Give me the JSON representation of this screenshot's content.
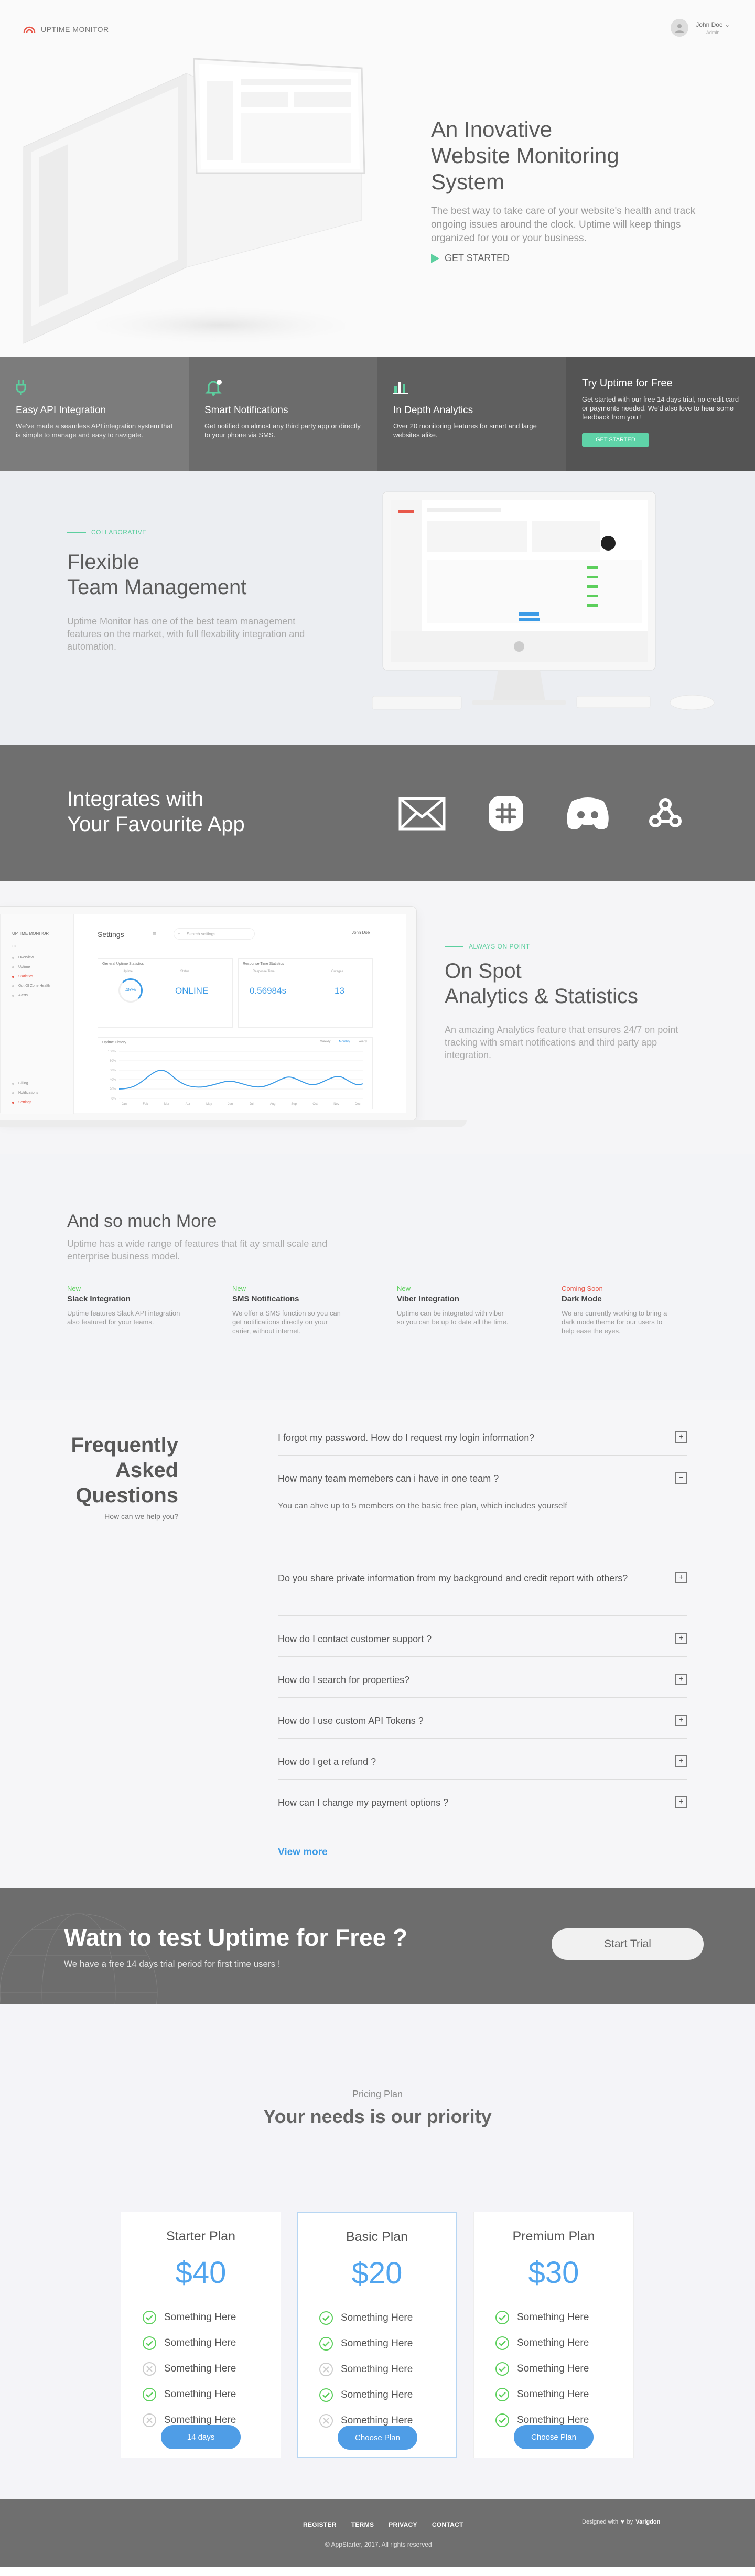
{
  "brand": {
    "logo_text": "UPTIME MONITOR",
    "accent": "#e8584a"
  },
  "user": {
    "name": "John Doe",
    "role": "Admin"
  },
  "hero": {
    "title_lines": [
      "An Inovative",
      "Website Monitoring",
      "System"
    ],
    "description": "The best way to take care of your website's health and track ongoing issues around the clock. Uptime will keep things organized for you or your business.",
    "cta": "GET STARTED"
  },
  "features": [
    {
      "title": "Easy API Integration",
      "text": "We've made a seamless API integration system that is simple to manage and easy to navigate.",
      "bg": "#7c7c7c",
      "icon": "plug-icon"
    },
    {
      "title": "Smart Notifications",
      "text": "Get notified on almost any third party app or directly to your phone via SMS.",
      "bg": "#6c6c6c",
      "icon": "bell-icon"
    },
    {
      "title": "In Depth Analytics",
      "text": "Over 20 monitoring features for smart and large websites alike.",
      "bg": "#5f5f5f",
      "icon": "bar-chart-icon"
    },
    {
      "title": "Try Uptime for Free",
      "text": "Get started with our free 14 days trial, no credit card or payments needed. We'd also love to hear some feedback from you !",
      "bg": "#545454",
      "button": "GET STARTED"
    }
  ],
  "team": {
    "tag": "COLLABORATIVE",
    "title_lines": [
      "Flexible",
      "Team Management"
    ],
    "description": "Uptime Monitor has one of the best team management features on the market, with full flexability integration and automation."
  },
  "integrations": {
    "title_lines": [
      "Integrates with",
      "Your Favourite App"
    ],
    "apps": [
      "mail-icon",
      "slack-icon",
      "discord-icon",
      "webhook-icon"
    ]
  },
  "analytics": {
    "tag": "ALWAYS ON POINT",
    "title_lines": [
      "On Spot",
      "Analytics & Statistics"
    ],
    "description": "An amazing Analytics feature that ensures 24/7 on point tracking with smart notifications and third party app integration."
  },
  "dashboard": {
    "page": "Settings",
    "search": "Search settings",
    "user": "John Doe",
    "nav": [
      "Overview",
      "Uptime",
      "Statistics",
      "Out Of Zone Health",
      "Alerts"
    ],
    "nav2": [
      "Billing",
      "Notifications",
      "Settings"
    ],
    "stats": [
      {
        "label": "Uptime",
        "value": "45%"
      },
      {
        "label": "Status",
        "value": "ONLINE"
      },
      {
        "label": "Response Time",
        "value": "0.56984s"
      },
      {
        "label": "Outages",
        "value": "13"
      }
    ],
    "panel1": "General Uptime Statistics",
    "panel2": "Response Time Statistics",
    "chart_title": "Uptime History",
    "chart_tabs": [
      "Weekly",
      "Monthly",
      "Yearly"
    ],
    "yticks": [
      "100%",
      "80%",
      "60%",
      "40%",
      "20%",
      "0%"
    ],
    "xticks": [
      "Jan",
      "Feb",
      "Mar",
      "Apr",
      "May",
      "Jun",
      "Jul",
      "Aug",
      "Sep",
      "Oct",
      "Nov",
      "Dec"
    ]
  },
  "more": {
    "title": "And so much More",
    "description": "Uptime has a wide range of features that fit ay small scale and enterprise business model.",
    "items": [
      {
        "tag": "New",
        "tag_color": "#5ccf5c",
        "title": "Slack Integration",
        "text": "Uptime features Slack API integration also featured for your teams."
      },
      {
        "tag": "New",
        "tag_color": "#5ccf5c",
        "title": "SMS Notifications",
        "text": "We offer a SMS function so you can get notifications directly on your carier, without internet."
      },
      {
        "tag": "New",
        "tag_color": "#5ccf5c",
        "title": "Viber Integration",
        "text": "Uptime can be integrated with viber so you can be up to date all the time."
      },
      {
        "tag": "Coming Soon",
        "tag_color": "#e8584a",
        "title": "Dark Mode",
        "text": "We are currently working to bring a dark mode theme for our users to help ease the eyes."
      }
    ]
  },
  "faq": {
    "title_lines": [
      "Frequently",
      "Asked",
      "Questions"
    ],
    "subtitle": "How can we help you?",
    "view_all": "View more",
    "items": [
      {
        "q": "I forgot my password. How do I request my login information?"
      },
      {
        "q": "How many team memebers can i have  in one team ?",
        "a": "You can ahve up to 5 members on the basic free plan, which includes yourself"
      },
      {
        "q": "Do you share private information from my background and credit report with others?"
      },
      {
        "q": "How do I contact customer support ?"
      },
      {
        "q": "How do I search for properties?"
      },
      {
        "q": "How do I use custom API Tokens ?"
      },
      {
        "q": "How do I get a refund ?"
      },
      {
        "q": "How can I change my payment options ?"
      }
    ]
  },
  "cta": {
    "title": "Watn to test Uptime for Free ?",
    "text": "We have a free 14 days trial period for first time users !",
    "button": "Start Trial"
  },
  "pricing": {
    "label": "Pricing Plan",
    "title": "Your needs is our priority",
    "plans": [
      {
        "name": "Starter Plan",
        "price": "$40",
        "button": "14 days",
        "features": [
          [
            "Something Here",
            true
          ],
          [
            "Something Here",
            true
          ],
          [
            "Something Here",
            false
          ],
          [
            "Something Here",
            true
          ],
          [
            "Something Here",
            false
          ]
        ]
      },
      {
        "name": "Basic Plan",
        "price": "$20",
        "button": "Choose Plan",
        "features": [
          [
            "Something Here",
            true
          ],
          [
            "Something Here",
            true
          ],
          [
            "Something Here",
            false
          ],
          [
            "Something Here",
            true
          ],
          [
            "Something Here",
            false
          ]
        ]
      },
      {
        "name": "Premium Plan",
        "price": "$30",
        "button": "Choose Plan",
        "features": [
          [
            "Something Here",
            true
          ],
          [
            "Something Here",
            true
          ],
          [
            "Something Here",
            true
          ],
          [
            "Something Here",
            true
          ],
          [
            "Something Here",
            true
          ]
        ]
      }
    ]
  },
  "footer": {
    "links": [
      "REGISTER",
      "TERMS",
      "PRIVACY",
      "CONTACT"
    ],
    "copyright": "© AppStarter, 2017. All rights reserved",
    "designed_prefix": "Designed with",
    "designed_by": "by",
    "designer": "Varigdon"
  }
}
